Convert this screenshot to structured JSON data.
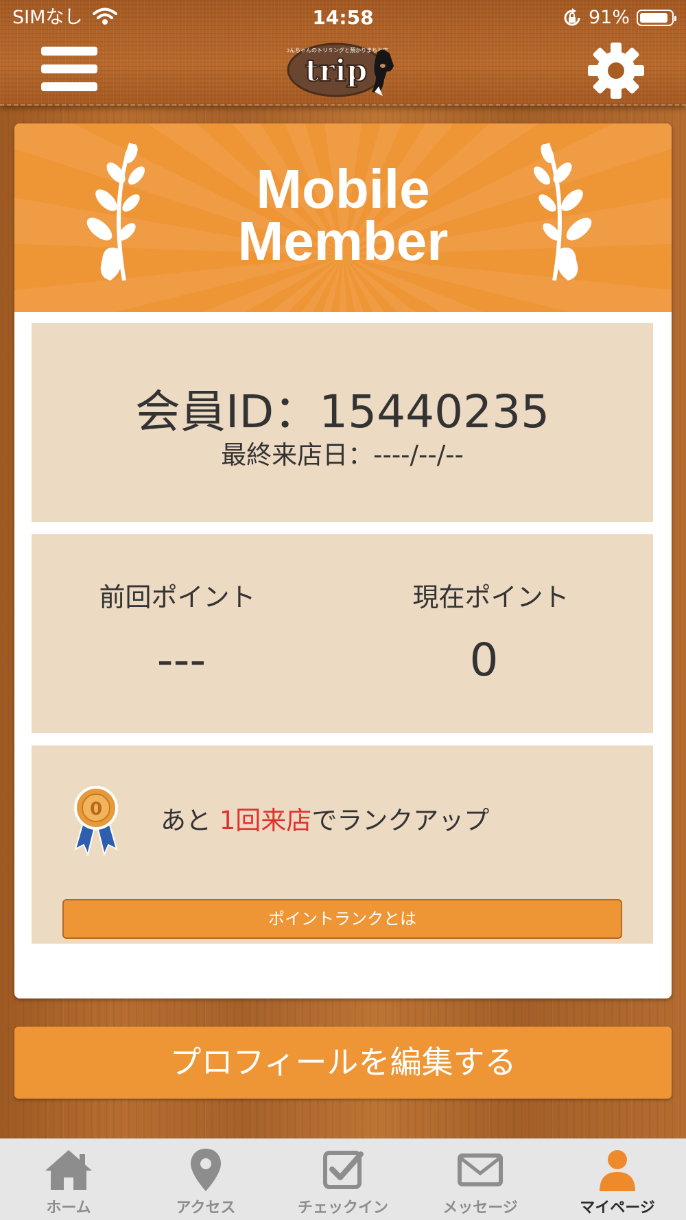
{
  "status_bar": {
    "carrier": "SIMなし",
    "time": "14:58",
    "battery": "91%",
    "battery_level": 0.91
  },
  "header": {
    "logo_text": "trip",
    "logo_tagline": "わんちゃんのトリミングと預かりまちお店"
  },
  "banner": {
    "line1": "Mobile",
    "line2": "Member"
  },
  "member": {
    "id_text": "会員ID：15440235",
    "last_visit_text": "最終来店日：----/--/--"
  },
  "points": {
    "previous_label": "前回ポイント",
    "previous_value": "---",
    "current_label": "現在ポイント",
    "current_value": "0"
  },
  "rank": {
    "prefix": "あと ",
    "highlight": "1回来店",
    "suffix": "でランクアップ",
    "badge_text": "0",
    "button_label": "ポイントランクとは"
  },
  "edit_profile_label": "プロフィールを編集する",
  "tabs": [
    {
      "label": "ホーム",
      "icon": "home-icon"
    },
    {
      "label": "アクセス",
      "icon": "map-pin-icon"
    },
    {
      "label": "チェックイン",
      "icon": "checkbox-icon"
    },
    {
      "label": "メッセージ",
      "icon": "envelope-icon"
    },
    {
      "label": "マイページ",
      "icon": "person-icon",
      "active": true
    }
  ],
  "colors": {
    "accent": "#ee9536",
    "panel": "#eddac3",
    "highlight": "#e0322d",
    "wood": "#b06a2e"
  }
}
